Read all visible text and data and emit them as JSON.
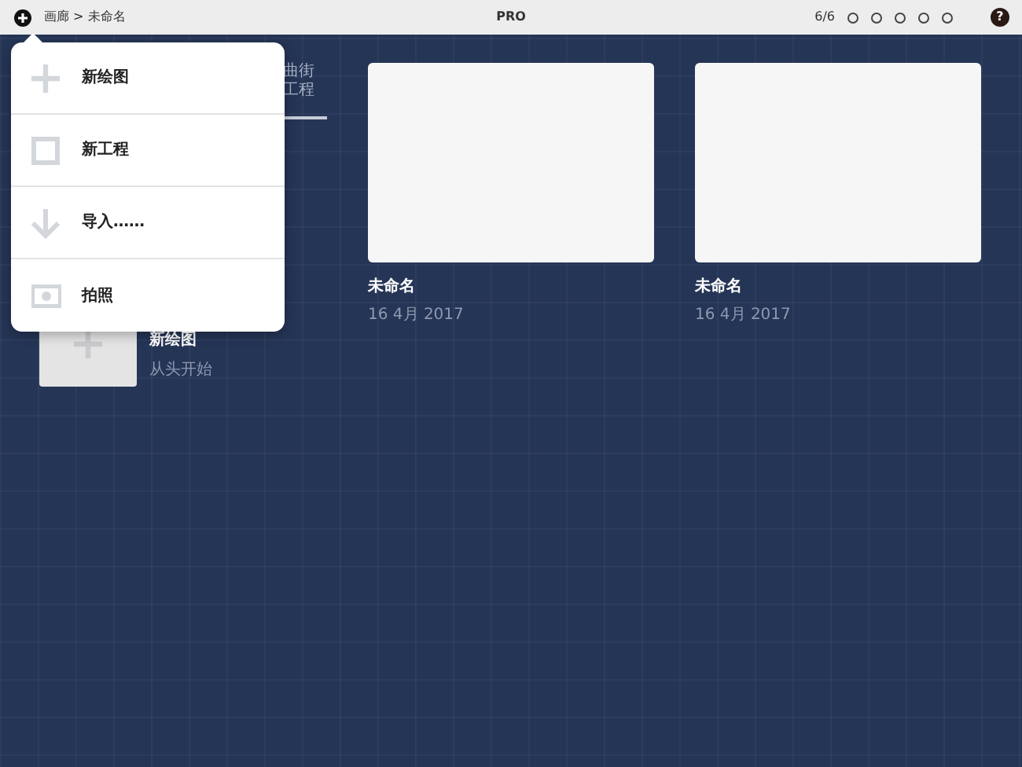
{
  "top_bar": {
    "breadcrumb": "画廊 > 未命名",
    "title": "PRO",
    "page_count": "6/6",
    "page_dots": [
      {
        "selected": false
      },
      {
        "selected": false
      },
      {
        "selected": false
      },
      {
        "selected": false
      },
      {
        "selected": false
      }
    ],
    "help": "?"
  },
  "background_tab": {
    "lines": [
      "曲街",
      "工程"
    ]
  },
  "new_tile": {
    "title": "新绘图",
    "subtitle": "从头开始"
  },
  "drawings": [
    {
      "title": "未命名",
      "date": "16 4月 2017"
    },
    {
      "title": "未命名",
      "date": "16 4月 2017"
    }
  ],
  "menu": [
    {
      "kind": "plus",
      "label": "新绘图"
    },
    {
      "kind": "square",
      "label": "新工程"
    },
    {
      "kind": "arrow",
      "label": "导入……"
    },
    {
      "kind": "camera",
      "label": "拍照"
    }
  ]
}
